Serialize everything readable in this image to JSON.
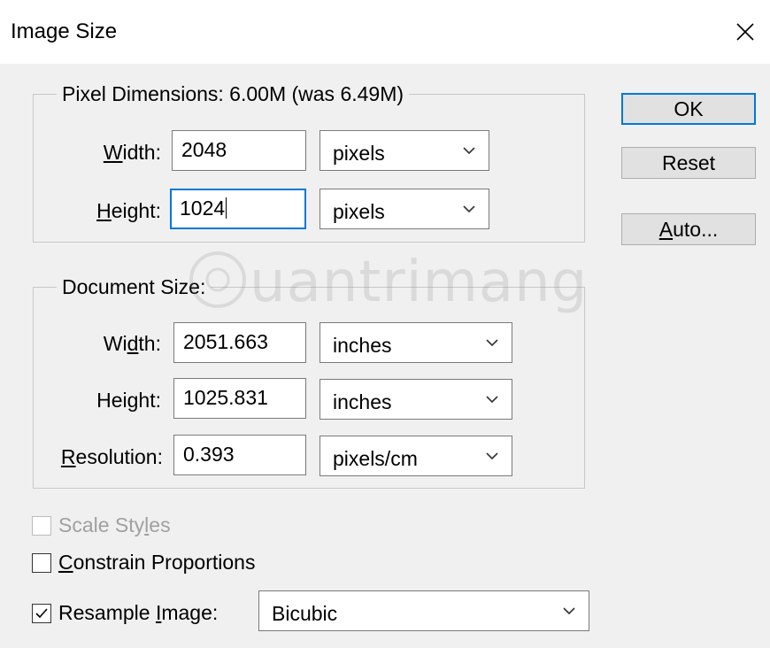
{
  "window": {
    "title": "Image Size"
  },
  "pixel_dimensions": {
    "legend": "Pixel Dimensions:  6.00M (was 6.49M)",
    "width": {
      "label_pre": "",
      "label_acc": "W",
      "label_post": "idth:",
      "value": "2048",
      "unit": "pixels"
    },
    "height": {
      "label_pre": "",
      "label_acc": "H",
      "label_post": "eight:",
      "value": "1024",
      "unit": "pixels"
    }
  },
  "document_size": {
    "legend": "Document Size:",
    "width": {
      "label_pre": "Wi",
      "label_acc": "d",
      "label_post": "th:",
      "value": "2051.663",
      "unit": "inches"
    },
    "height": {
      "label_pre": "Hei",
      "label_acc": "g",
      "label_post": "ht:",
      "value": "1025.831",
      "unit": "inches"
    },
    "resolution": {
      "label_pre": "",
      "label_acc": "R",
      "label_post": "esolution:",
      "value": "0.393",
      "unit": "pixels/cm"
    }
  },
  "options": {
    "scale_styles": {
      "pre": "Scale Sty",
      "acc": "l",
      "post": "es",
      "checked": false,
      "enabled": false
    },
    "constrain": {
      "pre": "",
      "acc": "C",
      "post": "onstrain Proportions",
      "checked": false
    },
    "resample": {
      "pre": "Resample ",
      "acc": "I",
      "post": "mage:",
      "checked": true,
      "method": "Bicubic"
    }
  },
  "buttons": {
    "ok": "OK",
    "reset": "Reset",
    "auto_pre": "",
    "auto_acc": "A",
    "auto_post": "uto..."
  },
  "watermark": "uantrimang",
  "colors": {
    "focus": "#0078d7",
    "dialog_bg": "#f0f0f0"
  }
}
